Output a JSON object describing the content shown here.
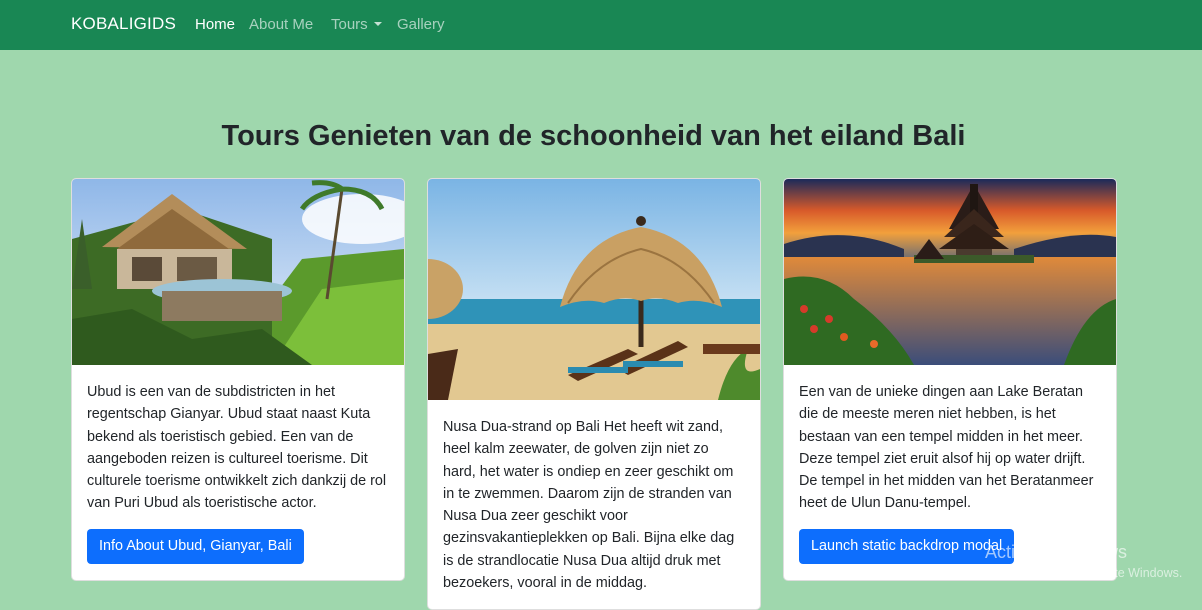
{
  "navbar": {
    "brand": "KOBALIGIDS",
    "links": [
      {
        "label": "Home",
        "active": true
      },
      {
        "label": "About Me"
      },
      {
        "label": "Tours",
        "dropdown": true
      },
      {
        "label": "Gallery"
      }
    ]
  },
  "main": {
    "heading": "Tours Genieten van de schoonheid van het eiland Bali",
    "cards": [
      {
        "image": "ubud-villa-jungle-photo",
        "text": "Ubud is een van de subdistricten in het regentschap Gianyar. Ubud staat naast Kuta bekend als toeristisch gebied. Een van de aangeboden reizen is cultureel toerisme. Dit culturele toerisme ontwikkelt zich dankzij de rol van Puri Ubud als toeristische actor.",
        "button": "Info About Ubud, Gianyar, Bali"
      },
      {
        "image": "nusa-dua-beach-umbrella-photo",
        "text": "Nusa Dua-strand op Bali Het heeft wit zand, heel kalm zeewater, de golven zijn niet zo hard, het water is ondiep en zeer geschikt om in te zwemmen. Daarom zijn de stranden van Nusa Dua zeer geschikt voor gezinsvakantieplekken op Bali. Bijna elke dag is de strandlocatie Nusa Dua altijd druk met bezoekers, vooral in de middag."
      },
      {
        "image": "lake-beratan-temple-sunset-photo",
        "text": "Een van de unieke dingen aan Lake Beratan die de meeste meren niet hebben, is het bestaan van een tempel midden in het meer. Deze tempel ziet eruit alsof hij op water drijft. De tempel in het midden van het Beratanmeer heet de Ulun Danu-tempel.",
        "button": "Launch static backdrop modal"
      }
    ]
  },
  "watermark": {
    "title": "Activate Windows",
    "subtitle": "Go to Settings to activate Windows."
  },
  "colors": {
    "navbar": "#198754",
    "page_background": "#9fd7ad",
    "button": "#0d6efd"
  }
}
